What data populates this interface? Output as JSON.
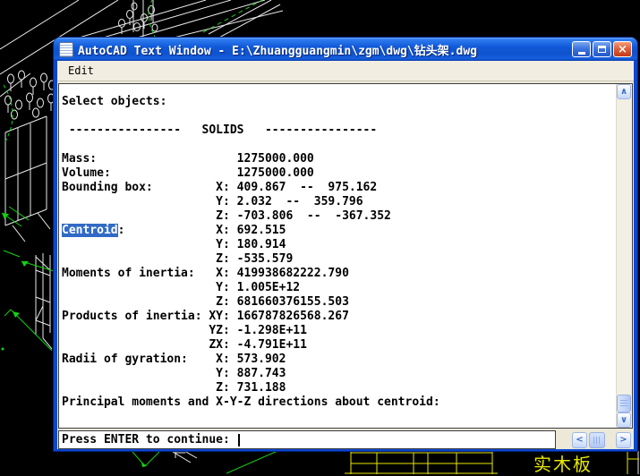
{
  "colors": {
    "canvas": "#000000",
    "titlebar_blue": "#1257D8",
    "selection": "#316AC5",
    "cad_white": "#E8E8E8",
    "cad_green": "#12D312",
    "cad_yellow": "#E8E800"
  },
  "window": {
    "title": "AutoCAD Text Window - E:\\Zhuangguangmin\\zgm\\dwg\\钻头架.dwg",
    "icons": {
      "window": "text-document",
      "minimize": "_",
      "maximize": "❐",
      "close": "×"
    }
  },
  "menu": {
    "items": [
      "Edit"
    ]
  },
  "console": {
    "lines": [
      {
        "text": "Select objects: "
      },
      {
        "text": ""
      },
      {
        "text": " ----------------   SOLIDS   ----------------"
      },
      {
        "text": ""
      },
      {
        "text": "Mass:                    1275000.000"
      },
      {
        "text": "Volume:                  1275000.000"
      },
      {
        "text": "Bounding box:         X: 409.867  --  975.162"
      },
      {
        "text": "                      Y: 2.032  --  359.796"
      },
      {
        "text": "                      Z: -703.806  --  -367.352"
      },
      {
        "selected": "Centroid",
        "text": ":             X: 692.515"
      },
      {
        "text": "                      Y: 180.914"
      },
      {
        "text": "                      Z: -535.579"
      },
      {
        "text": "Moments of inertia:   X: 419938682222.790"
      },
      {
        "text": "                      Y: 1.005E+12"
      },
      {
        "text": "                      Z: 681660376155.503"
      },
      {
        "text": "Products of inertia: XY: 166787826568.267"
      },
      {
        "text": "                     YZ: -1.298E+11"
      },
      {
        "text": "                     ZX: -4.791E+11"
      },
      {
        "text": "Radii of gyration:    X: 573.902"
      },
      {
        "text": "                      Y: 887.743"
      },
      {
        "text": "                      Z: 731.188"
      },
      {
        "text": "Principal moments and X-Y-Z directions about centroid: "
      }
    ]
  },
  "prompt": {
    "text": "Press ENTER to continue: "
  },
  "scrollbars": {
    "up": "∧",
    "down": "∨",
    "left": "<",
    "right": ">"
  },
  "drawing": {
    "label": "实木板"
  }
}
